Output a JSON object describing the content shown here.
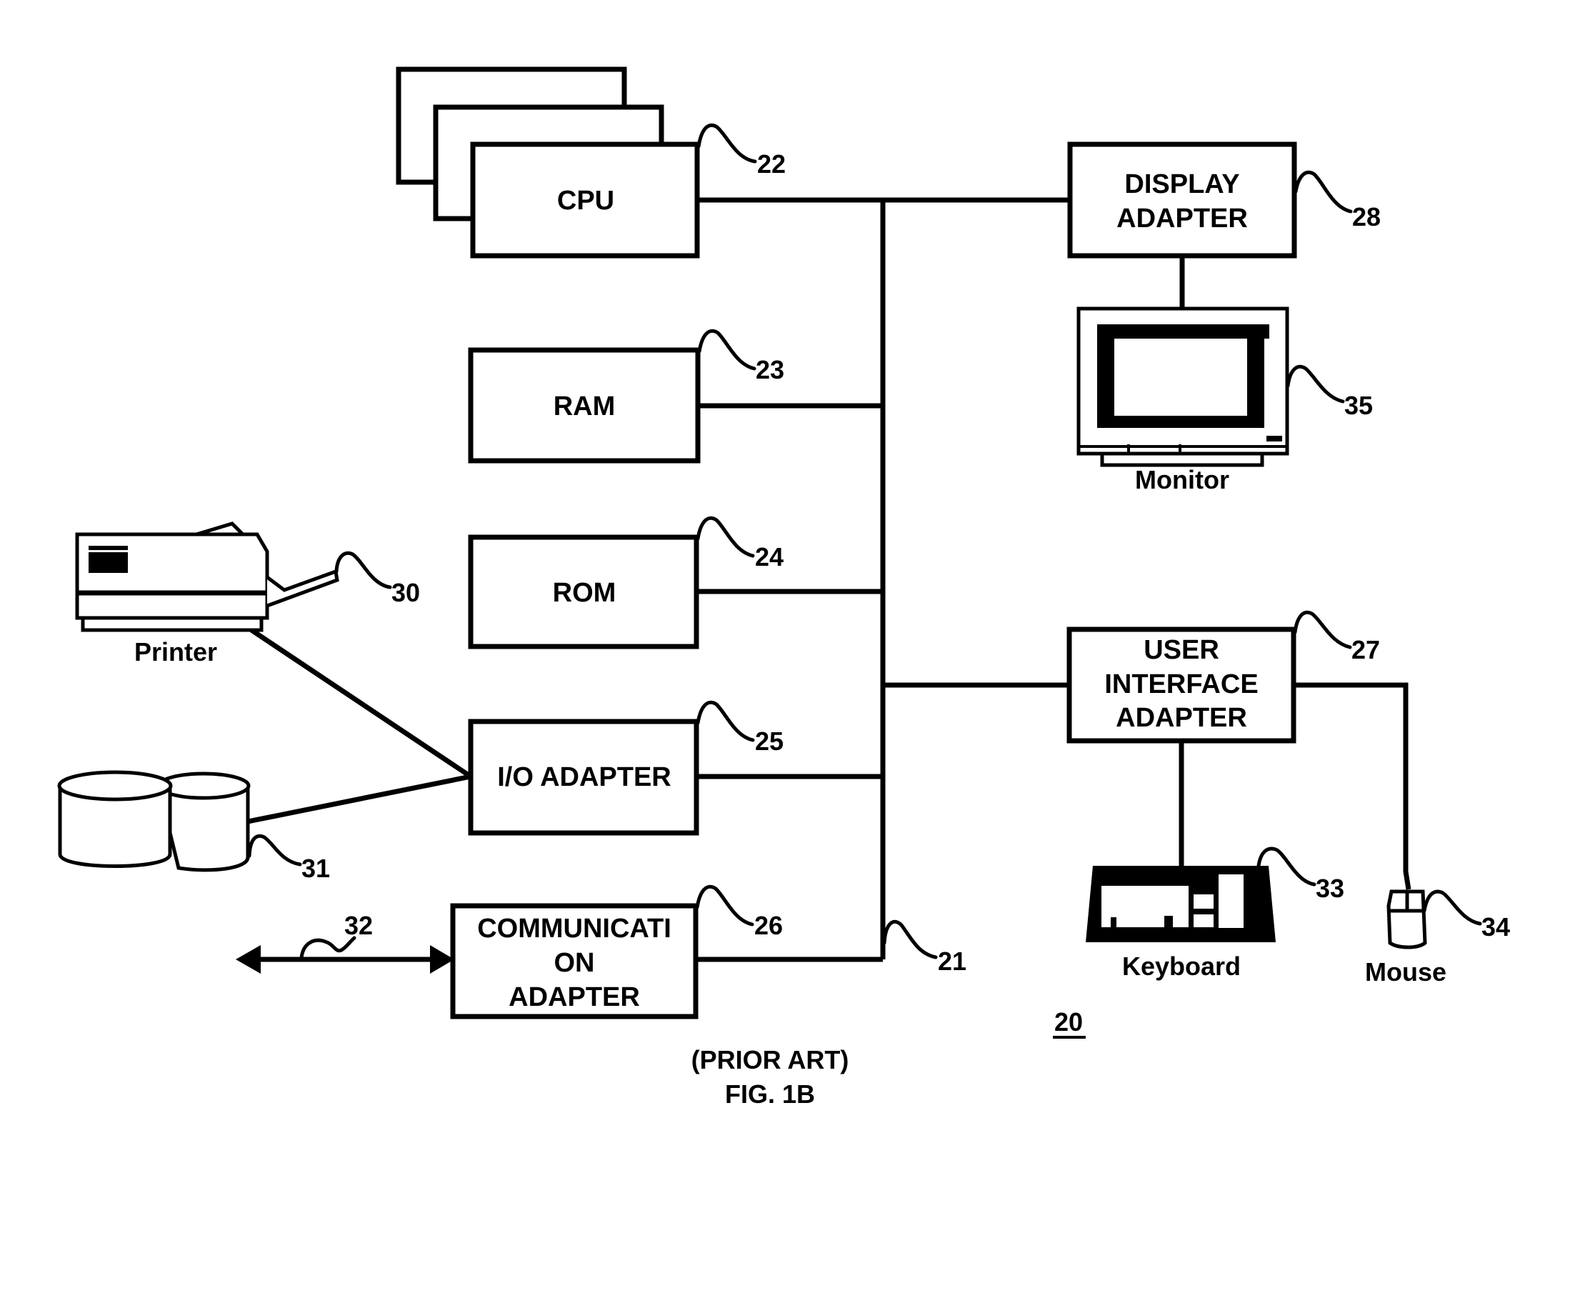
{
  "figure": {
    "caption_line1": "(PRIOR ART)",
    "caption_line2": "FIG. 1B",
    "system_ref": "20"
  },
  "components": {
    "cpu": {
      "label": "CPU",
      "ref": "22"
    },
    "ram": {
      "label": "RAM",
      "ref": "23"
    },
    "rom": {
      "label": "ROM",
      "ref": "24"
    },
    "io_adapter": {
      "label": "I/O ADAPTER",
      "ref": "25"
    },
    "comm_adapter": {
      "label_lines": [
        "COMMUNICATI",
        "ON",
        "ADAPTER"
      ],
      "ref": "26"
    },
    "user_interface_adapter": {
      "label_lines": [
        "USER",
        "INTERFACE",
        "ADAPTER"
      ],
      "ref": "27"
    },
    "display_adapter": {
      "label_lines": [
        "DISPLAY",
        "ADAPTER"
      ],
      "ref": "28"
    },
    "printer": {
      "label": "Printer",
      "ref": "30"
    },
    "disk_storage": {
      "ref": "31"
    },
    "network_link": {
      "ref": "32"
    },
    "keyboard": {
      "label": "Keyboard",
      "ref": "33"
    },
    "mouse": {
      "label": "Mouse",
      "ref": "34"
    },
    "monitor": {
      "label": "Monitor",
      "ref": "35"
    },
    "system_bus": {
      "ref": "21"
    }
  }
}
